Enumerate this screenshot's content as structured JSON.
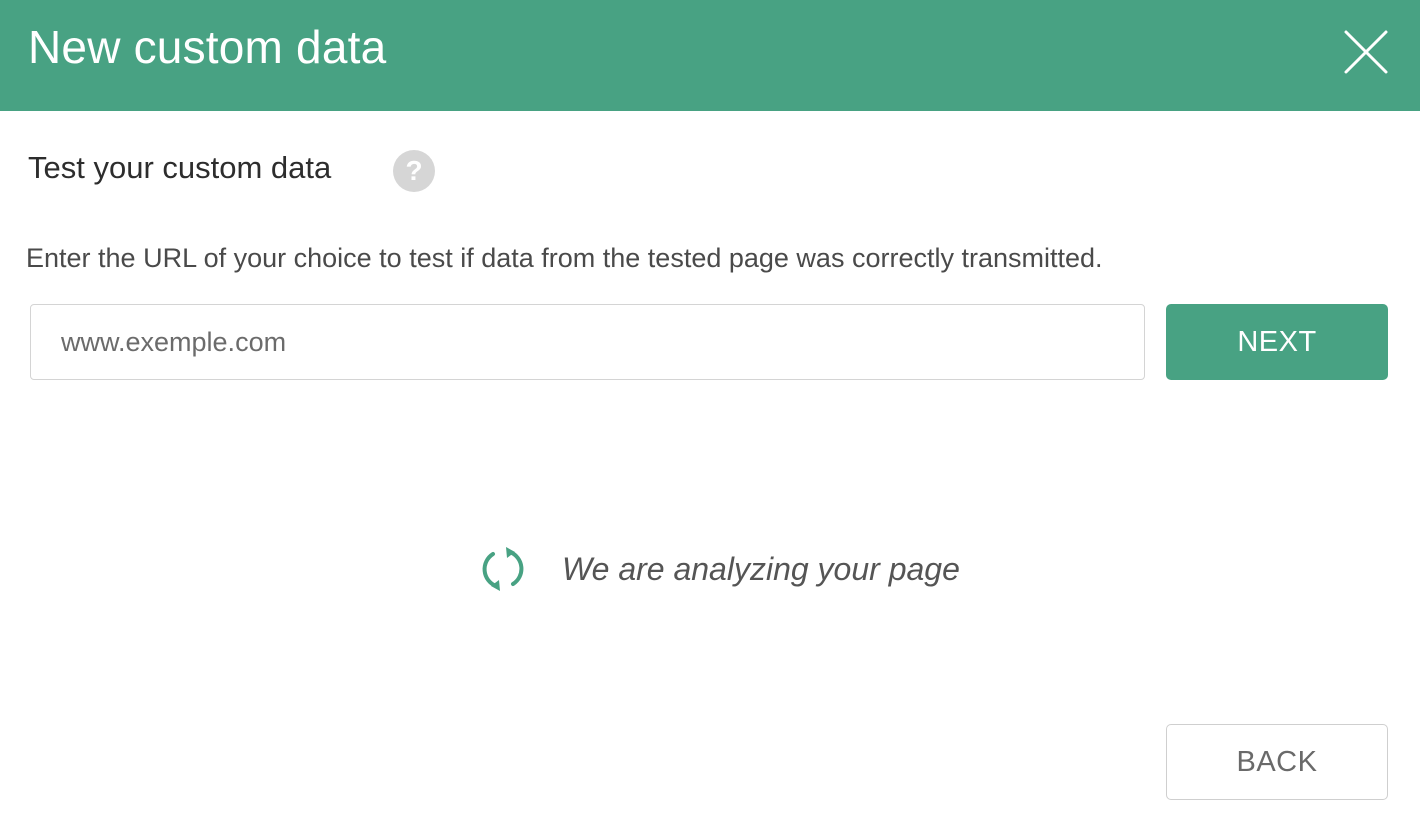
{
  "dialog": {
    "title": "New custom data",
    "close_icon": "close-icon",
    "accent_color": "#48a283"
  },
  "section": {
    "title": "Test your custom data",
    "help_icon": "help-icon",
    "help_glyph": "?"
  },
  "description": "Enter the URL of your choice to test if data from the tested page was correctly transmitted.",
  "url_input": {
    "value": "",
    "placeholder": "www.exemple.com"
  },
  "next_button": {
    "label": "NEXT"
  },
  "status": {
    "icon": "refresh-icon",
    "text": "We are analyzing your page"
  },
  "back_button": {
    "label": "BACK"
  }
}
